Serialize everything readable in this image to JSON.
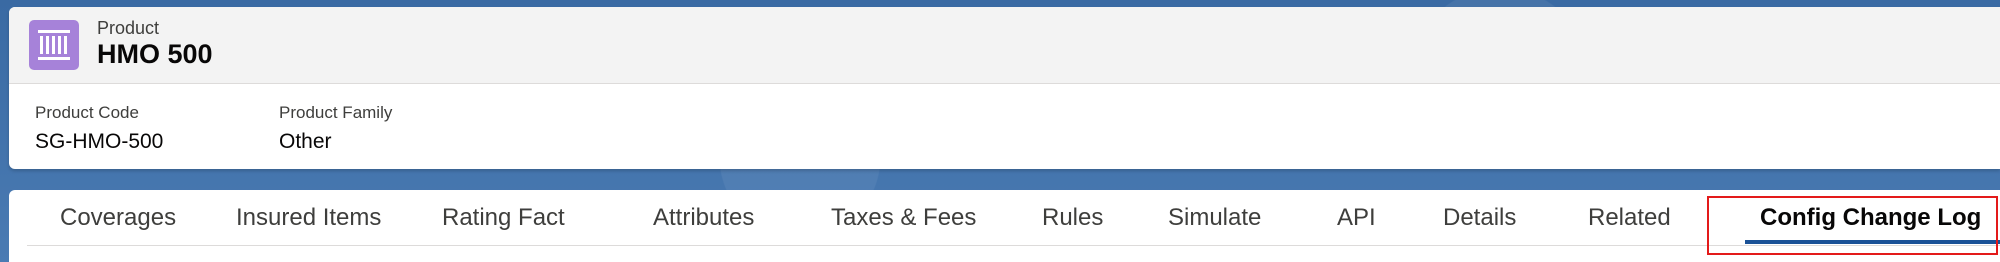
{
  "header": {
    "object_type": "Product",
    "record_name": "HMO 500",
    "icon": "product-barcode-icon",
    "icon_color": "#a682d9"
  },
  "fields": [
    {
      "label": "Product Code",
      "value": "SG-HMO-500"
    },
    {
      "label": "Product Family",
      "value": "Other"
    }
  ],
  "tabs": [
    {
      "label": "Coverages"
    },
    {
      "label": "Insured Items"
    },
    {
      "label": "Rating Fact"
    },
    {
      "label": "Attributes"
    },
    {
      "label": "Taxes & Fees"
    },
    {
      "label": "Rules"
    },
    {
      "label": "Simulate"
    },
    {
      "label": "API"
    },
    {
      "label": "Details"
    },
    {
      "label": "Related"
    },
    {
      "label": "Config Change Log",
      "active": true
    }
  ],
  "colors": {
    "active_tab_underline": "#1b5297",
    "highlight_border": "#e31a1a"
  }
}
